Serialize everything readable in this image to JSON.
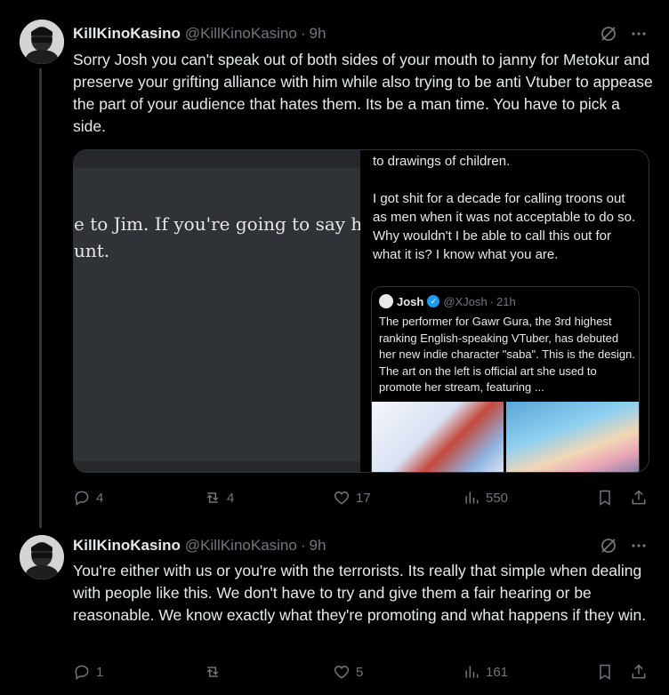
{
  "tweets": [
    {
      "author": {
        "name": "KillKinoKasino",
        "handle": "@KillKinoKasino",
        "time": "9h"
      },
      "text": "Sorry Josh you can't speak out of both sides of your mouth to janny for Metokur and preserve your grifting alliance with him while also trying to be anti Vtuber to appease the part of your audience that hates them. Its be a man time. You have to pick a side.",
      "media": {
        "left_text": "e to Jim. If you're going to say he \"\nunt.",
        "right_paragraphs": [
          "to drawings of children.",
          "I got shit for a decade for calling troons out as men when it was not acceptable to do so. Why wouldn't I be able to call this out for what it is? I know what you are."
        ],
        "quote": {
          "name": "Josh",
          "handle": "@XJosh",
          "time": "21h",
          "text": "The performer for Gawr Gura, the 3rd highest ranking English-speaking VTuber, has debuted her new indie character \"saba\". This is the design. The art on the left is official art she used to promote her stream, featuring ..."
        }
      },
      "stats": {
        "replies": "4",
        "retweets": "4",
        "likes": "17",
        "views": "550"
      }
    },
    {
      "author": {
        "name": "KillKinoKasino",
        "handle": "@KillKinoKasino",
        "time": "9h"
      },
      "text": "You're either with us or you're with the terrorists. Its really that simple when dealing with people like this. We don't have to try and give them a fair hearing or be reasonable. We know exactly what they're promoting and what happens if they win.",
      "stats": {
        "replies": "1",
        "retweets": "",
        "likes": "5",
        "views": "161"
      }
    }
  ],
  "separator_dot": "·",
  "more_icon": "more-horizontal-icon",
  "grok_icon": "grok-slash-icon"
}
